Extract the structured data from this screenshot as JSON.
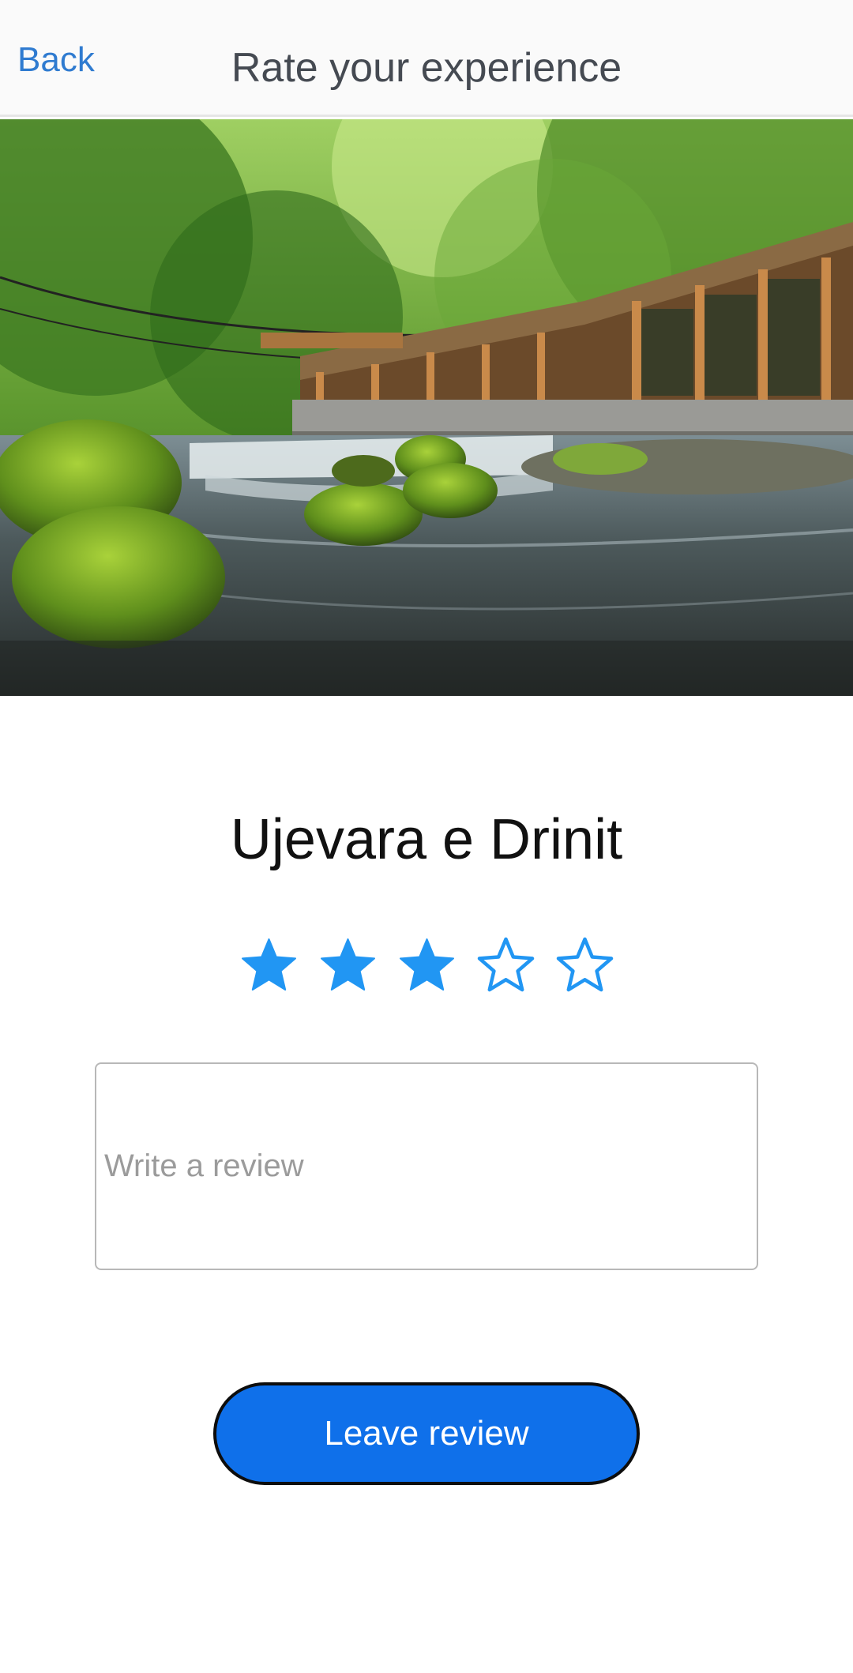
{
  "header": {
    "back_label": "Back",
    "title": "Rate your experience"
  },
  "hero": {
    "image_subject": "river-waterfall-restaurant-photo"
  },
  "place": {
    "name": "Ujevara e Drinit"
  },
  "rating": {
    "value": 3,
    "max": 5,
    "color": "#2196f3"
  },
  "review": {
    "placeholder": "Write a review",
    "value": ""
  },
  "actions": {
    "submit_label": "Leave review",
    "submit_color": "#0f70ea"
  }
}
